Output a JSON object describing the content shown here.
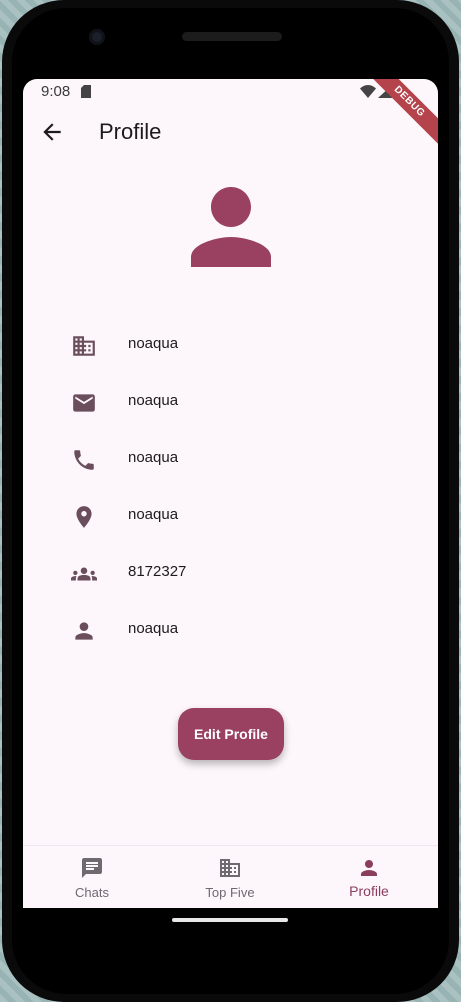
{
  "status_bar": {
    "time": "9:08",
    "debug_banner": "DEBUG"
  },
  "app_bar": {
    "title": "Profile"
  },
  "profile_fields": [
    {
      "icon": "business-icon",
      "value": "noaqua"
    },
    {
      "icon": "mail-icon",
      "value": "noaqua"
    },
    {
      "icon": "phone-icon",
      "value": "noaqua"
    },
    {
      "icon": "location-pin-icon",
      "value": "noaqua"
    },
    {
      "icon": "group-icon",
      "value": "8172327"
    },
    {
      "icon": "person-icon",
      "value": "noaqua"
    }
  ],
  "edit_button": {
    "label": "Edit Profile"
  },
  "bottom_nav": {
    "items": [
      {
        "label": "Chats",
        "icon": "chat-icon"
      },
      {
        "label": "Top Five",
        "icon": "business-icon"
      },
      {
        "label": "Profile",
        "icon": "person-icon",
        "active": true
      }
    ]
  },
  "colors": {
    "accent": "#9a4060",
    "icon": "#6b4e5b",
    "background": "#fdf7fb"
  }
}
